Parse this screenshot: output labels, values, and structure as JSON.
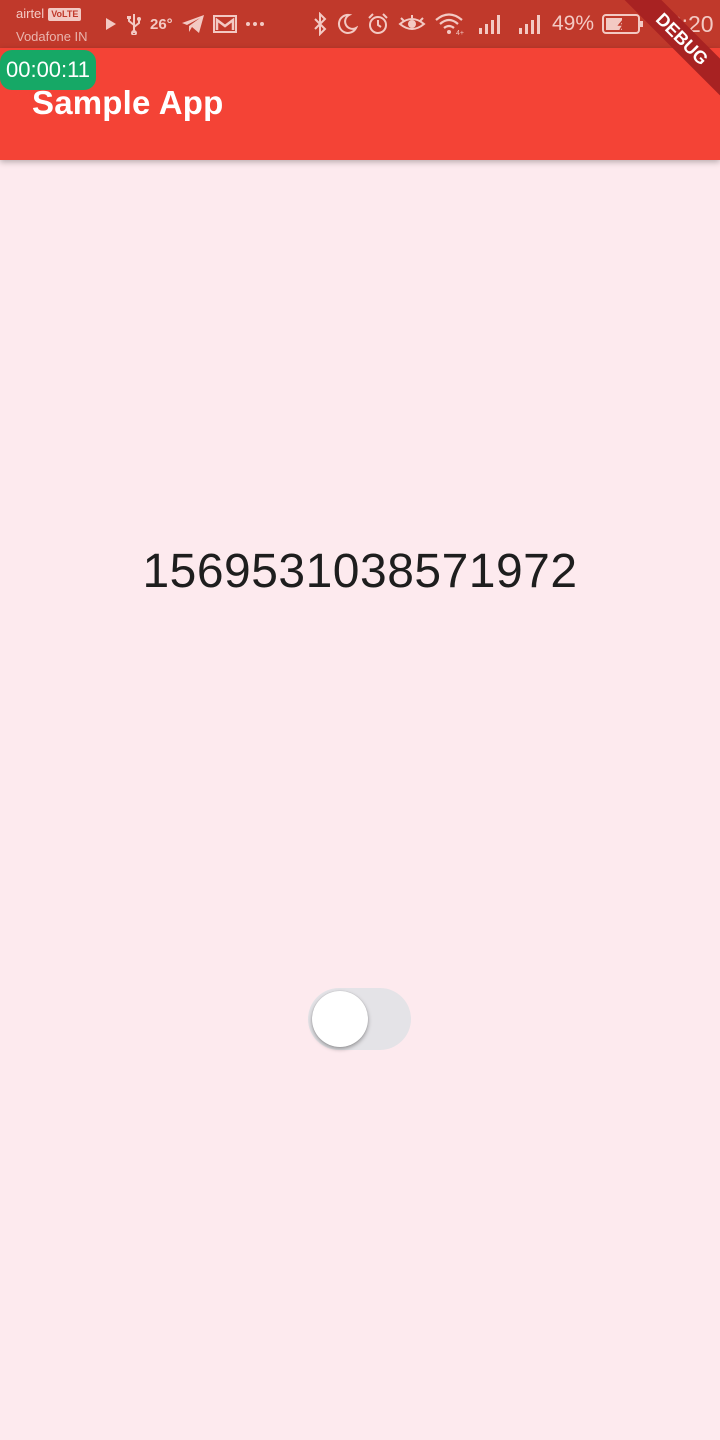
{
  "status_bar": {
    "carrier_primary": "airtel",
    "volte_badge": "VoLTE",
    "carrier_secondary": "Vodafone IN",
    "temperature": "26°",
    "battery_percent": "49%",
    "time": "02:20",
    "icons_left": [
      "play-icon",
      "usb-icon",
      "telegram-icon",
      "gmail-icon",
      "more-dots-icon"
    ],
    "icons_right": [
      "bluetooth-icon",
      "moon-icon",
      "alarm-icon",
      "eye-icon",
      "wifi-icon",
      "signal-icon",
      "signal-icon",
      "battery-icon"
    ]
  },
  "timer": {
    "label": "00:00:11",
    "color": "#16a866"
  },
  "debug_banner": {
    "label": "DEBUG"
  },
  "app_bar": {
    "title": "Sample App",
    "color": "#f44336"
  },
  "main": {
    "number": "1569531038571972",
    "toggle": {
      "on": false
    },
    "background": "#fdeaee"
  }
}
